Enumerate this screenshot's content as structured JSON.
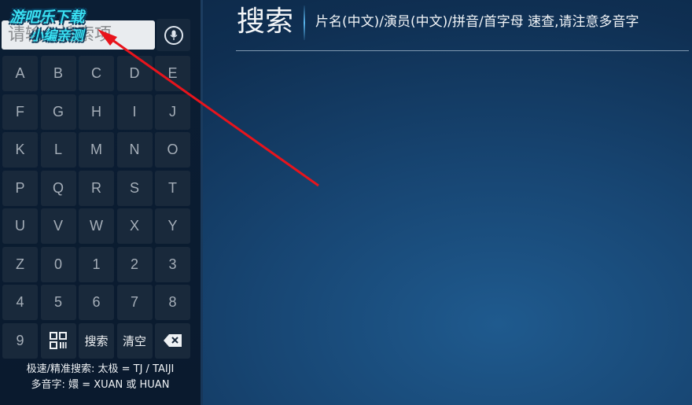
{
  "search": {
    "placeholder": "请输入搜索项"
  },
  "keyboard": {
    "keys": [
      "A",
      "B",
      "C",
      "D",
      "E",
      "F",
      "G",
      "H",
      "I",
      "J",
      "K",
      "L",
      "M",
      "N",
      "O",
      "P",
      "Q",
      "R",
      "S",
      "T",
      "U",
      "V",
      "W",
      "X",
      "Y",
      "Z",
      "0",
      "1",
      "2",
      "3",
      "4",
      "5",
      "6",
      "7",
      "8",
      "9"
    ],
    "search_label": "搜索",
    "clear_label": "清空"
  },
  "hints": {
    "line1": "极速/精准搜索: 太极 = TJ / TAIJI",
    "line2": "多音字: 嬛 = XUAN 或 HUAN"
  },
  "header": {
    "title": "搜索",
    "hint": "片名(中文)/演员(中文)/拼音/首字母 速查,请注意多音字"
  },
  "watermark": {
    "line1": "游吧乐下载",
    "line2": "小编亲测"
  },
  "colors": {
    "arrow": "#e8141c",
    "watermark": "#39e0f2",
    "key_bg": "#19293b",
    "panel_bg": "#0b1e34"
  }
}
